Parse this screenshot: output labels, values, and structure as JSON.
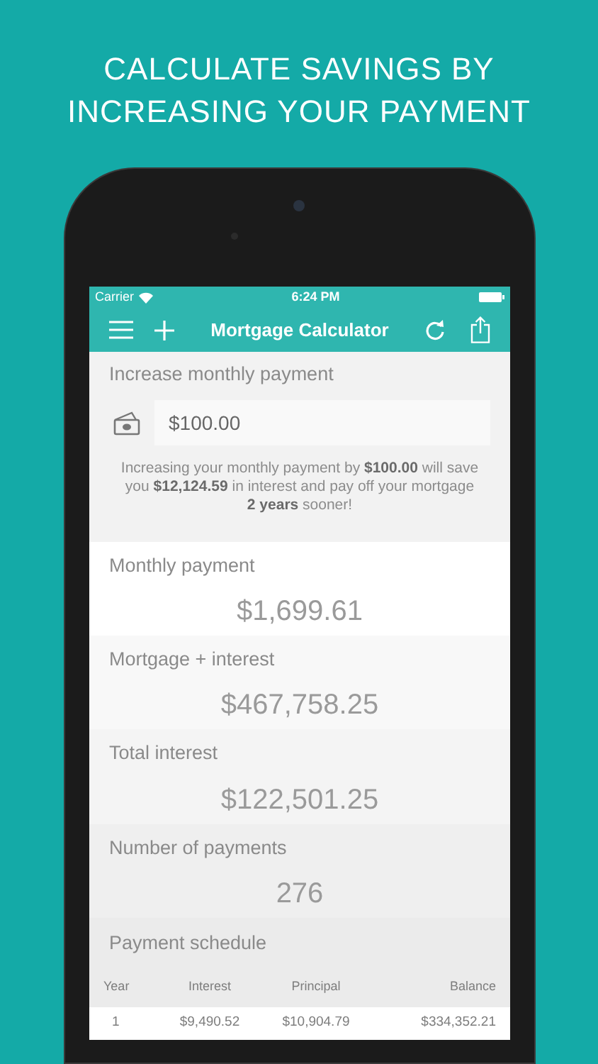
{
  "headline_lines": [
    "CALCULATE SAVINGS BY",
    "INCREASING YOUR PAYMENT"
  ],
  "status_bar": {
    "carrier": "Carrier",
    "time": "6:24 PM"
  },
  "nav": {
    "title": "Mortgage Calculator"
  },
  "increase": {
    "label": "Increase monthly payment",
    "amount": "$100.00",
    "message": "Increasing your monthly payment by **$100.00** will save you **$12,124.59** in interest and pay off your mortgage **2 years** sooner!"
  },
  "results": [
    {
      "label": "Monthly payment",
      "value": "$1,699.61"
    },
    {
      "label": "Mortgage + interest",
      "value": "$467,758.25"
    },
    {
      "label": "Total interest",
      "value": "$122,501.25"
    },
    {
      "label": "Number of payments",
      "value": "276"
    }
  ],
  "schedule": {
    "title": "Payment schedule",
    "columns": [
      "Year",
      "Interest",
      "Principal",
      "Balance"
    ],
    "rows": [
      [
        "1",
        "$9,490.52",
        "$10,904.79",
        "$334,352.21"
      ]
    ]
  }
}
